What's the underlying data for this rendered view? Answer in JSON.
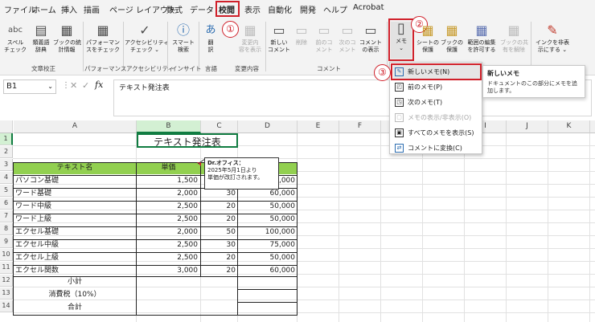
{
  "menubar": {
    "items": [
      "ファイル",
      "ホーム",
      "挿入",
      "描画",
      "ページ レイアウト",
      "数式",
      "データ",
      "校閲",
      "表示",
      "自動化",
      "開発",
      "ヘルプ",
      "Acrobat"
    ],
    "active": "校閲"
  },
  "ribbon": {
    "buttons": [
      {
        "label1": "スペル",
        "label2": "チェック",
        "icon": "abc"
      },
      {
        "label1": "類義語",
        "label2": "辞典",
        "icon": "▤"
      },
      {
        "label1": "ブックの統",
        "label2": "計情報",
        "icon": "▦"
      },
      {
        "label1": "パフォーマン",
        "label2": "スをチェック",
        "icon": "▦"
      },
      {
        "label1": "アクセシビリティ",
        "label2": "チェック ⌄",
        "icon": "✓"
      },
      {
        "label1": "スマート",
        "label2": "検索",
        "icon": "ⓘ"
      },
      {
        "label1": "翻",
        "label2": "訳",
        "icon": "あ"
      },
      {
        "label1": "変更内",
        "label2": "容を表示",
        "icon": "▦"
      },
      {
        "label1": "新しい",
        "label2": "コメント",
        "icon": "▭"
      },
      {
        "label1": "削除",
        "label2": "",
        "icon": "▭"
      },
      {
        "label1": "前のコ",
        "label2": "メント",
        "icon": "▭"
      },
      {
        "label1": "次のコ",
        "label2": "メント",
        "icon": "▭"
      },
      {
        "label1": "コメント",
        "label2": "の表示",
        "icon": "▭"
      },
      {
        "label1": "メモ",
        "label2": "⌄",
        "icon": "▯"
      },
      {
        "label1": "シートの",
        "label2": "保護",
        "icon": "▦"
      },
      {
        "label1": "ブックの",
        "label2": "保護",
        "icon": "▦"
      },
      {
        "label1": "範囲の編集",
        "label2": "を許可する",
        "icon": "▦"
      },
      {
        "label1": "ブックの共",
        "label2": "有を解除",
        "icon": "▦"
      },
      {
        "label1": "インクを非表",
        "label2": "示にする ⌄",
        "icon": "✎"
      }
    ],
    "groups": [
      "文章校正",
      "パフォーマンス",
      "アクセシビリティ",
      "インサイト",
      "言語",
      "変更内容",
      "コメント"
    ]
  },
  "namebox": {
    "value": "B1"
  },
  "formula": {
    "fx": "fx",
    "value": "テキスト発注表"
  },
  "columns": [
    "A",
    "B",
    "C",
    "D",
    "E",
    "F",
    "G",
    "H",
    "I",
    "J",
    "K",
    "L"
  ],
  "rows": [
    "1",
    "2",
    "3",
    "4",
    "5",
    "6",
    "7",
    "8",
    "9",
    "10",
    "11",
    "12",
    "13",
    "14"
  ],
  "sheet": {
    "title": "テキスト発注表",
    "headers": [
      "テキスト名",
      "単価",
      "",
      ""
    ],
    "items": [
      {
        "name": "パソコン基礎",
        "price": "1,500",
        "qty": "",
        "amount": "5,000"
      },
      {
        "name": "ワード基礎",
        "price": "2,000",
        "qty": "30",
        "amount": "60,000"
      },
      {
        "name": "ワード中級",
        "price": "2,500",
        "qty": "20",
        "amount": "50,000"
      },
      {
        "name": "ワード上級",
        "price": "2,500",
        "qty": "20",
        "amount": "50,000"
      },
      {
        "name": "エクセル基礎",
        "price": "2,000",
        "qty": "50",
        "amount": "100,000"
      },
      {
        "name": "エクセル中級",
        "price": "2,500",
        "qty": "30",
        "amount": "75,000"
      },
      {
        "name": "エクセル上級",
        "price": "2,500",
        "qty": "20",
        "amount": "50,000"
      },
      {
        "name": "エクセル関数",
        "price": "3,000",
        "qty": "20",
        "amount": "60,000"
      }
    ],
    "subtotal": "小計",
    "tax": "消費税（10%）",
    "total": "合計"
  },
  "comment": {
    "author": "Dr.オフィス：",
    "line1": "2025年5月1日より",
    "line2": "単価が改訂されます。"
  },
  "dropdown": {
    "items": [
      {
        "label": "新しいメモ(N)",
        "icon": "✎",
        "enabled": true
      },
      {
        "label": "前のメモ(P)",
        "icon": "◰",
        "enabled": true
      },
      {
        "label": "次のメモ(T)",
        "icon": "◳",
        "enabled": true
      },
      {
        "label": "メモの表示/非表示(O)",
        "icon": "▢",
        "enabled": false
      },
      {
        "label": "すべてのメモを表示(S)",
        "icon": "▣",
        "enabled": true
      },
      {
        "label": "コメントに変換(C)",
        "icon": "⇄",
        "enabled": true
      }
    ]
  },
  "tooltip": {
    "title": "新しいメモ",
    "body": "ドキュメントのこの部分にメモを追加します。"
  },
  "steps": [
    "①",
    "②",
    "③"
  ],
  "colors": {
    "accent": "#d0202a",
    "header_green": "#92d050",
    "selected_header": "#d3f0d3"
  }
}
